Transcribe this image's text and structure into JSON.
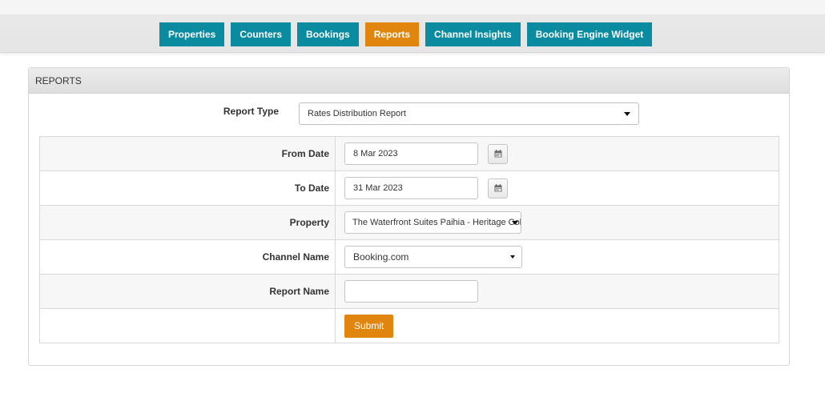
{
  "nav": {
    "items": [
      "Properties",
      "Counters",
      "Bookings",
      "Reports",
      "Channel Insights",
      "Booking Engine Widget"
    ],
    "active": "Reports"
  },
  "panel": {
    "title": "REPORTS"
  },
  "report_type": {
    "label": "Report Type",
    "value": "Rates Distribution Report"
  },
  "form": {
    "from_date": {
      "label": "From Date",
      "value": "8 Mar 2023"
    },
    "to_date": {
      "label": "To Date",
      "value": "31 Mar 2023"
    },
    "property": {
      "label": "Property",
      "value": "The Waterfront Suites Paihia - Heritage Collection"
    },
    "channel_name": {
      "label": "Channel Name",
      "value": "Booking.com"
    },
    "report_name": {
      "label": "Report Name",
      "value": ""
    },
    "submit_label": "Submit"
  },
  "colors": {
    "nav": "#0a8ba0",
    "accent": "#e0860e"
  },
  "icons": {
    "calendar": "calendar-icon",
    "dropdown": "chevron-down-icon"
  }
}
